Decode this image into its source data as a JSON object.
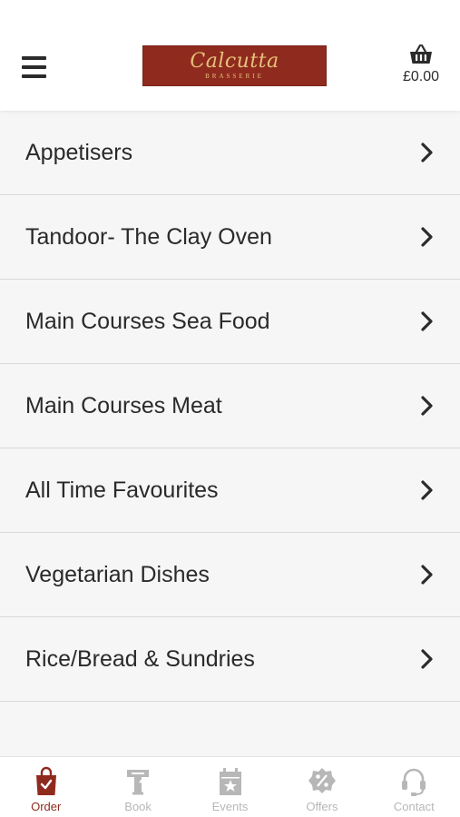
{
  "header": {
    "logo_text": "Calcutta",
    "logo_subtext": "BRASSERIE",
    "cart_total": "£0.00"
  },
  "menu": {
    "items": [
      {
        "label": "Appetisers"
      },
      {
        "label": "Tandoor- The Clay Oven"
      },
      {
        "label": "Main Courses Sea Food"
      },
      {
        "label": "Main Courses Meat"
      },
      {
        "label": "All Time Favourites"
      },
      {
        "label": "Vegetarian Dishes"
      },
      {
        "label": "Rice/Bread & Sundries"
      }
    ]
  },
  "bottom_nav": {
    "items": [
      {
        "label": "Order",
        "icon": "shopping-bag-icon",
        "active": true
      },
      {
        "label": "Book",
        "icon": "table-booking-icon",
        "active": false
      },
      {
        "label": "Events",
        "icon": "calendar-star-icon",
        "active": false
      },
      {
        "label": "Offers",
        "icon": "percent-badge-icon",
        "active": false
      },
      {
        "label": "Contact",
        "icon": "headset-icon",
        "active": false
      }
    ]
  },
  "colors": {
    "brand": "#8f2b1e",
    "logo_text": "#e6c07a",
    "nav_inactive": "#b7b7b7"
  }
}
